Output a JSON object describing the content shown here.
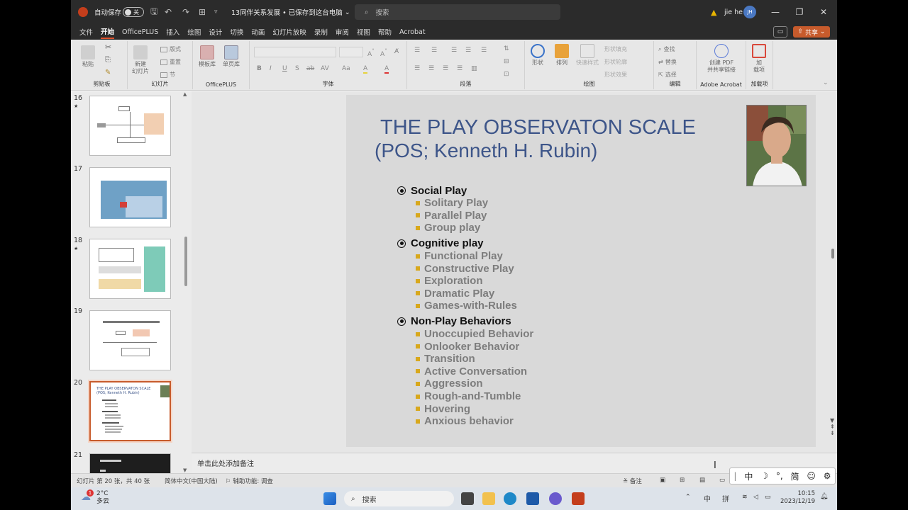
{
  "titlebar": {
    "autosave_label": "自动保存",
    "autosave_state": "关",
    "document_title": "13同伴关系发展 • 已保存到这台电脑",
    "search_placeholder": "搜索",
    "user_name": "jie he",
    "user_initials": "JH"
  },
  "menu": {
    "tabs": [
      "文件",
      "开始",
      "OfficePLUS",
      "插入",
      "绘图",
      "设计",
      "切换",
      "动画",
      "幻灯片放映",
      "录制",
      "审阅",
      "视图",
      "帮助",
      "Acrobat"
    ],
    "active_tab": "开始",
    "share_label": "共享"
  },
  "ribbon": {
    "clipboard": {
      "paste": "粘贴",
      "label": "剪贴板"
    },
    "slides": {
      "new_slide_1": "新建",
      "new_slide_2": "幻灯片",
      "layout": "版式",
      "reset": "重置",
      "section": "节",
      "label": "幻灯片"
    },
    "officeplus": {
      "template": "模板库",
      "single": "单页库",
      "label": "OfficePLUS"
    },
    "font": {
      "label": "字体",
      "buttons": [
        "B",
        "I",
        "U",
        "S",
        "ab",
        "AV",
        "Aa",
        "A",
        "A"
      ]
    },
    "paragraph": {
      "label": "段落"
    },
    "drawing": {
      "shape": "形状",
      "arrange": "排列",
      "quick_styles": "快速样式",
      "fill": "形状填充",
      "outline": "形状轮廓",
      "effects": "形状效果",
      "label": "绘图"
    },
    "editing": {
      "find": "查找",
      "replace": "替换",
      "select": "选择",
      "label": "编辑"
    },
    "acrobat": {
      "create_1": "创建 PDF",
      "create_2": "并共享链接",
      "label": "Adobe Acrobat"
    },
    "addins": {
      "add_1": "加",
      "add_2": "载项",
      "label": "加载项"
    }
  },
  "thumbnails": [
    {
      "number": "16",
      "star": "★"
    },
    {
      "number": "17",
      "star": ""
    },
    {
      "number": "18",
      "star": "★"
    },
    {
      "number": "19",
      "star": ""
    },
    {
      "number": "20",
      "star": "",
      "mini_title_1": "THE PLAY OBSERVATON SCALE",
      "mini_title_2": "(POS; Kenneth H. Rubin)"
    },
    {
      "number": "21",
      "star": ""
    }
  ],
  "slide": {
    "title_line1": "THE PLAY OBSERVATON SCALE",
    "title_line2": "(POS; Kenneth H. Rubin)",
    "sections": [
      {
        "heading": "Social Play",
        "items": [
          "Solitary Play",
          "Parallel Play",
          "Group play"
        ]
      },
      {
        "heading": "Cognitive play",
        "items": [
          "Functional Play",
          "Constructive Play",
          "Exploration",
          "Dramatic Play",
          "Games-with-Rules"
        ]
      },
      {
        "heading": "Non-Play Behaviors",
        "items": [
          "Unoccupied Behavior",
          "Onlooker Behavior",
          "Transition",
          "Active Conversation",
          "Aggression",
          "Rough-and-Tumble",
          "Hovering",
          "Anxious behavior"
        ]
      }
    ]
  },
  "notes": {
    "placeholder": "单击此处添加备注"
  },
  "statusbar": {
    "slide_info": "幻灯片 第 20 张，共 40 张",
    "language": "简体中文(中国大陆)",
    "accessibility": "辅助功能: 调查",
    "notes_btn": "备注"
  },
  "ime": {
    "items": [
      "中",
      "☽",
      "°,",
      "简",
      "☺",
      "⚙"
    ]
  },
  "taskbar": {
    "weather_temp": "2°C",
    "weather_desc": "多云",
    "weather_badge": "1",
    "search_label": "搜索",
    "tray_ime_1": "中",
    "tray_ime_2": "拼",
    "time": "10:15",
    "date": "2023/12/19"
  }
}
